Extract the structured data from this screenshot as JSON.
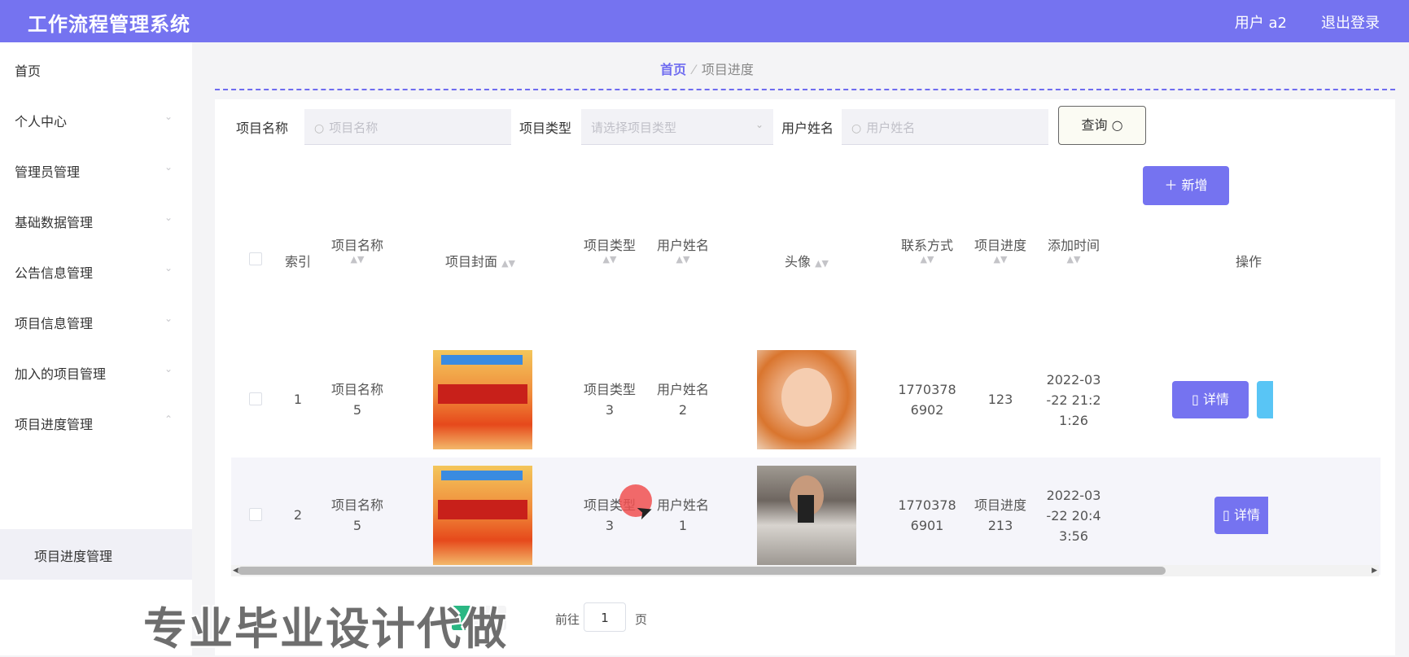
{
  "app": {
    "title": "工作流程管理系统",
    "user": "用户 a2",
    "logout": "退出登录"
  },
  "sidebar": {
    "items": [
      {
        "label": "首页"
      },
      {
        "label": "个人中心"
      },
      {
        "label": "管理员管理"
      },
      {
        "label": "基础数据管理"
      },
      {
        "label": "公告信息管理"
      },
      {
        "label": "项目信息管理"
      },
      {
        "label": "加入的项目管理"
      },
      {
        "label": "项目进度管理"
      }
    ],
    "subitem": {
      "label": "项目进度管理"
    }
  },
  "breadcrumb": {
    "home": "首页",
    "current": "项目进度"
  },
  "filters": {
    "name_label": "项目名称",
    "name_placeholder": "项目名称",
    "type_label": "项目类型",
    "type_placeholder": "请选择项目类型",
    "user_label": "用户姓名",
    "user_placeholder": "用户姓名",
    "query_button": "查询",
    "add_button": "新增"
  },
  "table": {
    "headers": {
      "index": "索引",
      "name": "项目名称",
      "cover": "项目封面",
      "type": "项目类型",
      "user": "用户姓名",
      "avatar": "头像",
      "contact": "联系方式",
      "progress": "项目进度",
      "time": "添加时间",
      "action": "操作"
    },
    "rows": [
      {
        "index": "1",
        "name1": "项目名称",
        "name2": "5",
        "type1": "项目类型",
        "type2": "3",
        "user1": "用户姓名",
        "user2": "2",
        "contact1": "1770378",
        "contact2": "6902",
        "progress1": "123",
        "progress2": "",
        "time1": "2022-03",
        "time2": "-22 21:2",
        "time3": "1:26",
        "detail": "详情"
      },
      {
        "index": "2",
        "name1": "项目名称",
        "name2": "5",
        "type1": "项目类型",
        "type2": "3",
        "user1": "用户姓名",
        "user2": "1",
        "contact1": "1770378",
        "contact2": "6901",
        "progress1": "项目进度",
        "progress2": "213",
        "time1": "2022-03",
        "time2": "-22 20:4",
        "time3": "3:56",
        "detail": "详情"
      }
    ]
  },
  "pager": {
    "goto": "前往",
    "page_value": "1",
    "page_suffix": "页"
  },
  "watermark": "专业毕业设计代做",
  "colors": {
    "accent": "#7573f0",
    "pager_active": "#2bb783"
  }
}
